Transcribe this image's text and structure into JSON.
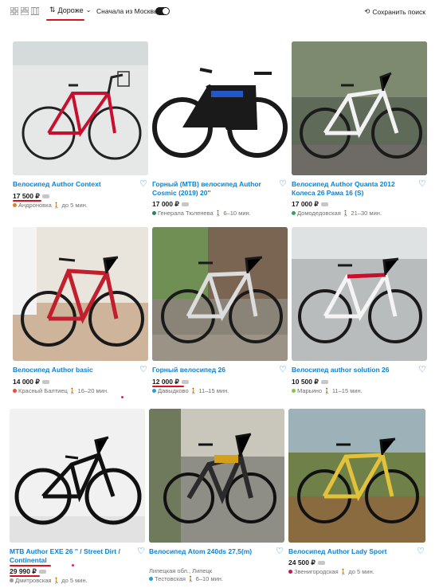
{
  "toolbar": {
    "sort_label": "Дороже",
    "moscow_label": "Сначала из Москвы",
    "save_search_label": "Сохранить поиск"
  },
  "listings": [
    {
      "title": "Велосипед Author Context",
      "price": "17 500 ₽",
      "station": "Андроновка",
      "time": "до 5 мин.",
      "station_color": "#e67e22"
    },
    {
      "title": "Горный (МТВ) велосипед Author Cosmic (2019) 20''",
      "price": "17 000 ₽",
      "station": "Генерала Тюленева",
      "time": "6–10 мин.",
      "station_color": "#1e8b55"
    },
    {
      "title": "Велосипед Author Quanta 2012 Колеса 26 Рама 16 (S)",
      "price": "17 000 ₽",
      "station": "Домодедовская",
      "time": "21–30 мин.",
      "station_color": "#2fa84f"
    },
    {
      "title": "Велосипед Author basic",
      "price": "14 000 ₽",
      "station": "Красный Балтиец",
      "time": "16–20 мин.",
      "station_color": "#e74c3c"
    },
    {
      "title": "Горный велосипед 26",
      "price": "12 000 ₽",
      "station": "Давыдково",
      "time": "11–15 мин.",
      "station_color": "#2a9fd6"
    },
    {
      "title": "Велосипед author solution 26",
      "price": "10 500 ₽",
      "station": "Марьино",
      "time": "11–15 мин.",
      "station_color": "#8bc34a"
    },
    {
      "title": "MTB Author EXE 26 '' / Street Dirt / Continental",
      "price": "29 990 ₽",
      "station": "Дмитровская",
      "time": "до 5 мин.",
      "station_color": "#9b9b9b"
    },
    {
      "title": "Велосипед Atom 240ds 27,5(m)",
      "price": "",
      "location": "Липецкая обл., Липецк",
      "station": "Тестовская",
      "time": "6–10 мин.",
      "station_color": "#2a9fd6"
    },
    {
      "title": "Велосипед Author Lady Sport",
      "price": "24 500 ₽",
      "station": "Звенигородская",
      "time": "до 5 мин.",
      "station_color": "#c2185b"
    }
  ]
}
